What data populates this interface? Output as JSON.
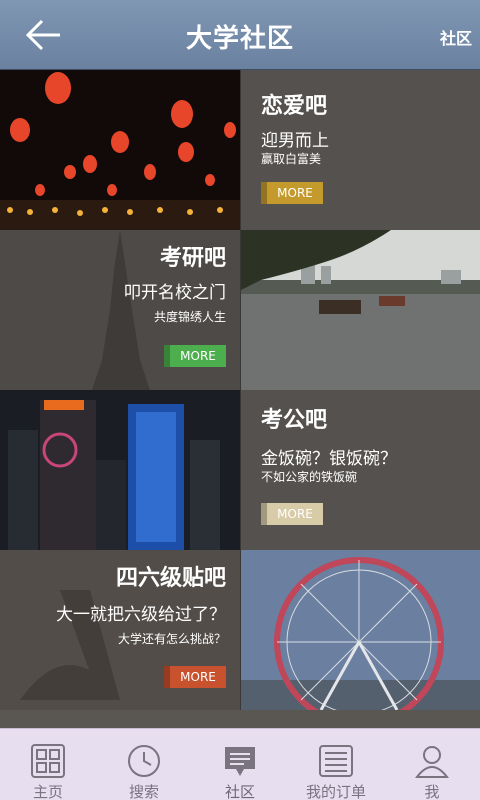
{
  "header": {
    "title": "大学社区",
    "right_label": "社区"
  },
  "cards": [
    {
      "title": "恋爱吧",
      "subtitle": "迎男而上",
      "desc": "赢取白富美",
      "more": "MORE",
      "accent": "#c59a2d"
    },
    {
      "title": "考研吧",
      "subtitle": "叩开名校之门",
      "desc": "共度锦绣人生",
      "more": "MORE",
      "accent": "#4cae4c"
    },
    {
      "title": "考公吧",
      "subtitle": "金饭碗？银饭碗？",
      "desc": "不如公家的铁饭碗",
      "more": "MORE",
      "accent": "#d8cca8"
    },
    {
      "title": "四六级贴吧",
      "subtitle": "大一就把六级给过了？",
      "desc": "大学还有怎么挑战？",
      "more": "MORE",
      "accent": "#c8512e"
    }
  ],
  "tabs": [
    {
      "label": "主页",
      "icon": "grid-icon"
    },
    {
      "label": "搜索",
      "icon": "clock-icon"
    },
    {
      "label": "社区",
      "icon": "chat-icon"
    },
    {
      "label": "我的订单",
      "icon": "list-icon"
    },
    {
      "label": "我",
      "icon": "user-icon"
    }
  ],
  "active_tab": "社区"
}
